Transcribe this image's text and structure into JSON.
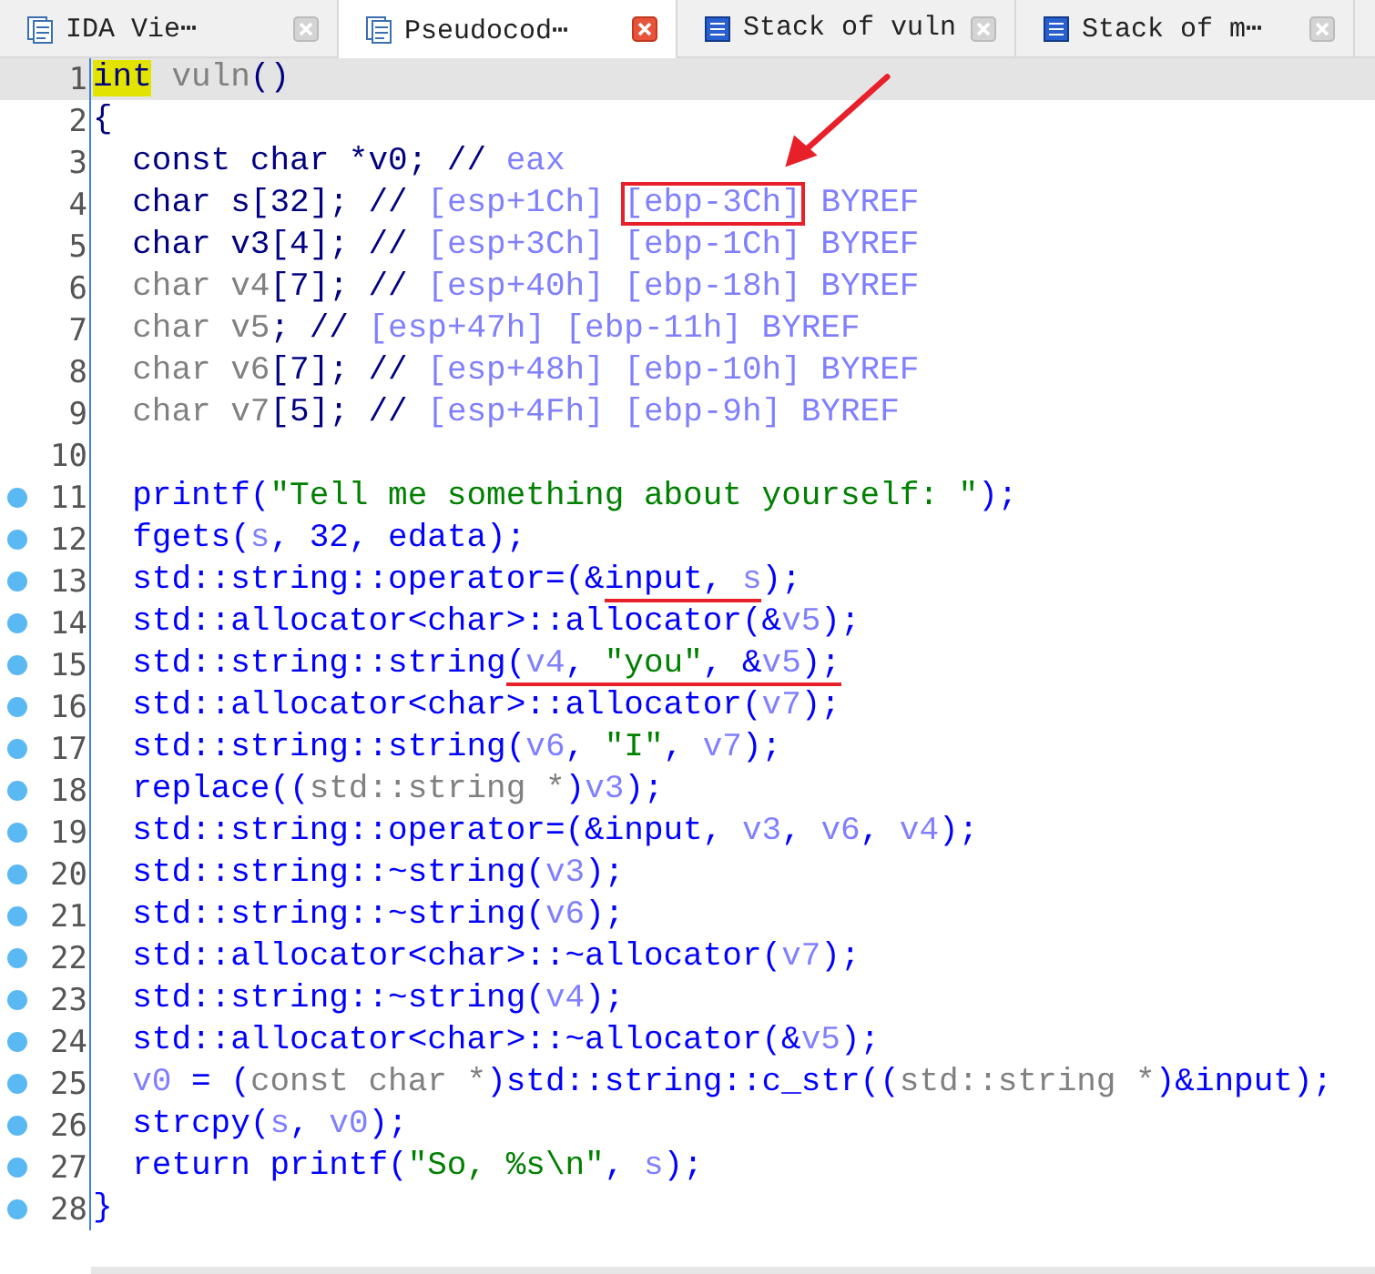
{
  "tabs": [
    {
      "label": "IDA Vie⋯",
      "kind": "view",
      "selected": false
    },
    {
      "label": "Pseudocod⋯",
      "kind": "view",
      "selected": true
    },
    {
      "label": "Stack of vuln",
      "kind": "stack",
      "selected": false
    },
    {
      "label": "Stack of m⋯",
      "kind": "stack",
      "selected": false
    }
  ],
  "arrow_annotation": true,
  "lines": [
    {
      "number": "1",
      "current": true,
      "breakpoint": false,
      "tokens": [
        {
          "text": "int",
          "kind": "kw"
        },
        {
          "text": " vuln",
          "kind": "type"
        },
        {
          "text": "()",
          "kind": "text"
        }
      ]
    },
    {
      "number": "2",
      "current": false,
      "breakpoint": false,
      "tokens": [
        {
          "text": "{",
          "kind": "text"
        }
      ]
    },
    {
      "number": "3",
      "current": false,
      "breakpoint": false,
      "tokens": [
        {
          "text": "  const char *v0; // ",
          "kind": "text"
        },
        {
          "text": "eax",
          "kind": "var"
        }
      ]
    },
    {
      "number": "4",
      "current": false,
      "breakpoint": false,
      "tokens": [
        {
          "text": "  char s[32]; // ",
          "kind": "text"
        },
        {
          "text": "[esp+1Ch] ",
          "kind": "var"
        },
        {
          "text": "[ebp-3Ch]",
          "kind": "var",
          "boxed": true
        },
        {
          "text": " BYREF",
          "kind": "var"
        }
      ]
    },
    {
      "number": "5",
      "current": false,
      "breakpoint": false,
      "tokens": [
        {
          "text": "  char v3[4]; // ",
          "kind": "text"
        },
        {
          "text": "[esp+3Ch] [ebp-1Ch] BYREF",
          "kind": "var"
        }
      ]
    },
    {
      "number": "6",
      "current": false,
      "breakpoint": false,
      "tokens": [
        {
          "text": "  char v4",
          "kind": "type"
        },
        {
          "text": "[7]; // ",
          "kind": "text"
        },
        {
          "text": "[esp+40h] [ebp-18h] BYREF",
          "kind": "var"
        }
      ]
    },
    {
      "number": "7",
      "current": false,
      "breakpoint": false,
      "tokens": [
        {
          "text": "  char v5",
          "kind": "type"
        },
        {
          "text": "; // ",
          "kind": "text"
        },
        {
          "text": "[esp+47h] [ebp-11h] BYREF",
          "kind": "var"
        }
      ]
    },
    {
      "number": "8",
      "current": false,
      "breakpoint": false,
      "tokens": [
        {
          "text": "  char v6",
          "kind": "type"
        },
        {
          "text": "[7]; // ",
          "kind": "text"
        },
        {
          "text": "[esp+48h] [ebp-10h] BYREF",
          "kind": "var"
        }
      ]
    },
    {
      "number": "9",
      "current": false,
      "breakpoint": false,
      "tokens": [
        {
          "text": "  char v7",
          "kind": "type"
        },
        {
          "text": "[5]; // ",
          "kind": "text"
        },
        {
          "text": "[esp+4Fh] [ebp-9h] BYREF",
          "kind": "var"
        }
      ]
    },
    {
      "number": "10",
      "current": false,
      "breakpoint": false
    },
    {
      "number": "11",
      "current": false,
      "breakpoint": true,
      "tokens": [
        {
          "text": "  printf(",
          "kind": "code"
        },
        {
          "text": "\"Tell me something about yourself: \"",
          "kind": "str"
        },
        {
          "text": ");",
          "kind": "code"
        }
      ]
    },
    {
      "number": "12",
      "current": false,
      "breakpoint": true,
      "tokens": [
        {
          "text": "  fgets(",
          "kind": "code"
        },
        {
          "text": "s",
          "kind": "var"
        },
        {
          "text": ", 32, edata);",
          "kind": "code"
        }
      ]
    },
    {
      "number": "13",
      "current": false,
      "breakpoint": true,
      "tokens": [
        {
          "text": "  std::string::operator=(&",
          "kind": "code"
        },
        {
          "text": "input, ",
          "kind": "code",
          "underlined": true
        },
        {
          "text": "s",
          "kind": "var",
          "underlined": true
        },
        {
          "text": ");",
          "kind": "code"
        }
      ]
    },
    {
      "number": "14",
      "current": false,
      "breakpoint": true,
      "tokens": [
        {
          "text": "  std::allocator<char>::allocator(&",
          "kind": "code"
        },
        {
          "text": "v5",
          "kind": "var"
        },
        {
          "text": ");",
          "kind": "code"
        }
      ]
    },
    {
      "number": "15",
      "current": false,
      "breakpoint": true,
      "tokens": [
        {
          "text": "  std::string::string",
          "kind": "code"
        },
        {
          "text": "(",
          "kind": "code",
          "underlined": true
        },
        {
          "text": "v4",
          "kind": "var",
          "underlined": true
        },
        {
          "text": ", ",
          "kind": "code",
          "underlined": true
        },
        {
          "text": "\"you\"",
          "kind": "str",
          "underlined": true
        },
        {
          "text": ", &",
          "kind": "code",
          "underlined": true
        },
        {
          "text": "v5",
          "kind": "var",
          "underlined": true
        },
        {
          "text": ");",
          "kind": "code",
          "underlined": true
        }
      ]
    },
    {
      "number": "16",
      "current": false,
      "breakpoint": true,
      "tokens": [
        {
          "text": "  std::allocator<char>::allocator(",
          "kind": "code"
        },
        {
          "text": "v7",
          "kind": "var"
        },
        {
          "text": ");",
          "kind": "code"
        }
      ]
    },
    {
      "number": "17",
      "current": false,
      "breakpoint": true,
      "tokens": [
        {
          "text": "  std::string::string(",
          "kind": "code"
        },
        {
          "text": "v6",
          "kind": "var"
        },
        {
          "text": ", ",
          "kind": "code"
        },
        {
          "text": "\"I\"",
          "kind": "str"
        },
        {
          "text": ", ",
          "kind": "code"
        },
        {
          "text": "v7",
          "kind": "var"
        },
        {
          "text": ");",
          "kind": "code"
        }
      ]
    },
    {
      "number": "18",
      "current": false,
      "breakpoint": true,
      "tokens": [
        {
          "text": "  replace((",
          "kind": "code"
        },
        {
          "text": "std::string *",
          "kind": "type"
        },
        {
          "text": ")",
          "kind": "code"
        },
        {
          "text": "v3",
          "kind": "var"
        },
        {
          "text": ");",
          "kind": "code"
        }
      ]
    },
    {
      "number": "19",
      "current": false,
      "breakpoint": true,
      "tokens": [
        {
          "text": "  std::string::operator=(&input, ",
          "kind": "code"
        },
        {
          "text": "v3",
          "kind": "var"
        },
        {
          "text": ", ",
          "kind": "code"
        },
        {
          "text": "v6",
          "kind": "var"
        },
        {
          "text": ", ",
          "kind": "code"
        },
        {
          "text": "v4",
          "kind": "var"
        },
        {
          "text": ");",
          "kind": "code"
        }
      ]
    },
    {
      "number": "20",
      "current": false,
      "breakpoint": true,
      "tokens": [
        {
          "text": "  std::string::~string(",
          "kind": "code"
        },
        {
          "text": "v3",
          "kind": "var"
        },
        {
          "text": ");",
          "kind": "code"
        }
      ]
    },
    {
      "number": "21",
      "current": false,
      "breakpoint": true,
      "tokens": [
        {
          "text": "  std::string::~string(",
          "kind": "code"
        },
        {
          "text": "v6",
          "kind": "var"
        },
        {
          "text": ");",
          "kind": "code"
        }
      ]
    },
    {
      "number": "22",
      "current": false,
      "breakpoint": true,
      "tokens": [
        {
          "text": "  std::allocator<char>::~allocator(",
          "kind": "code"
        },
        {
          "text": "v7",
          "kind": "var"
        },
        {
          "text": ");",
          "kind": "code"
        }
      ]
    },
    {
      "number": "23",
      "current": false,
      "breakpoint": true,
      "tokens": [
        {
          "text": "  std::string::~string(",
          "kind": "code"
        },
        {
          "text": "v4",
          "kind": "var"
        },
        {
          "text": ");",
          "kind": "code"
        }
      ]
    },
    {
      "number": "24",
      "current": false,
      "breakpoint": true,
      "tokens": [
        {
          "text": "  std::allocator<char>::~allocator(&",
          "kind": "code"
        },
        {
          "text": "v5",
          "kind": "var"
        },
        {
          "text": ");",
          "kind": "code"
        }
      ]
    },
    {
      "number": "25",
      "current": false,
      "breakpoint": true,
      "tokens": [
        {
          "text": "  v0",
          "kind": "var"
        },
        {
          "text": " = (",
          "kind": "code"
        },
        {
          "text": "const char *",
          "kind": "type"
        },
        {
          "text": ")std::string::c_str((",
          "kind": "code"
        },
        {
          "text": "std::string *",
          "kind": "type"
        },
        {
          "text": ")&input);",
          "kind": "code"
        }
      ]
    },
    {
      "number": "26",
      "current": false,
      "breakpoint": true,
      "tokens": [
        {
          "text": "  strcpy(",
          "kind": "code"
        },
        {
          "text": "s",
          "kind": "var"
        },
        {
          "text": ", ",
          "kind": "code"
        },
        {
          "text": "v0",
          "kind": "var"
        },
        {
          "text": ");",
          "kind": "code"
        }
      ]
    },
    {
      "number": "27",
      "current": false,
      "breakpoint": true,
      "tokens": [
        {
          "text": "  return printf(",
          "kind": "code"
        },
        {
          "text": "\"So, %s\\n\"",
          "kind": "str"
        },
        {
          "text": ", ",
          "kind": "code"
        },
        {
          "text": "s",
          "kind": "var"
        },
        {
          "text": ");",
          "kind": "code"
        }
      ]
    },
    {
      "number": "28",
      "current": false,
      "breakpoint": true,
      "tokens": [
        {
          "text": "}",
          "kind": "code"
        }
      ]
    }
  ]
}
